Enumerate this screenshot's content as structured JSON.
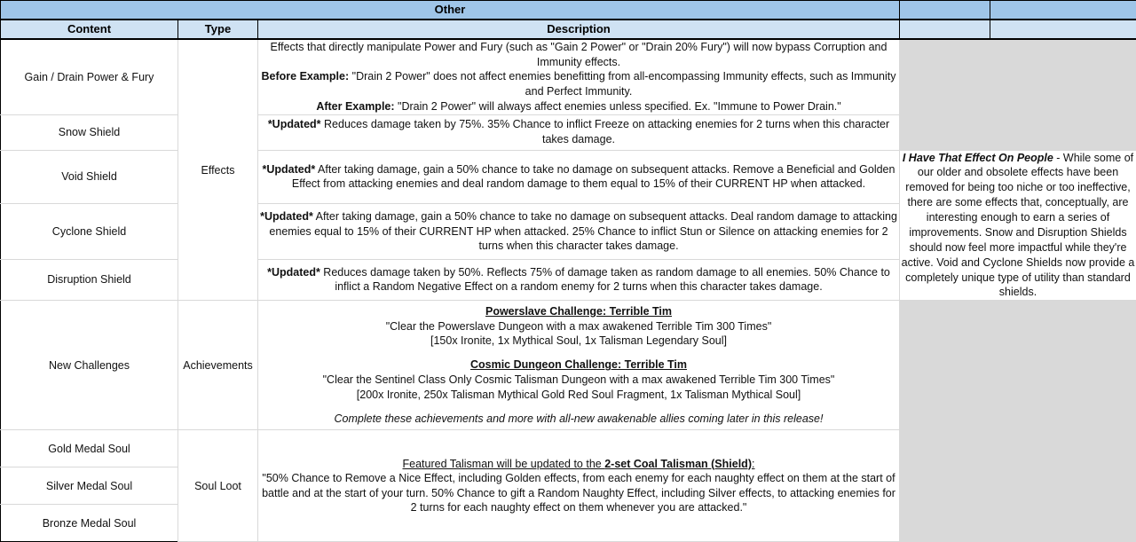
{
  "sheet": {
    "title": "Other",
    "columns": {
      "content": "Content",
      "type": "Type",
      "description": "Description",
      "extra_1": "",
      "extra_2": ""
    },
    "colors": {
      "title_bg": "#9fc5e8",
      "header_bg": "#cfe2f3",
      "filler_bg": "#d9d9d9",
      "grid_line": "#d9d9d9",
      "outline": "#000000",
      "text": "#111111"
    }
  },
  "rows": {
    "gain_drain": {
      "content": "Gain / Drain Power & Fury",
      "desc": {
        "p1": "Effects that directly manipulate Power and Fury (such as \"Gain 2 Power\" or \"Drain 20% Fury\") will now bypass Corruption and Immunity effects.",
        "before_label": "Before Example:",
        "before_text": " \"Drain 2 Power\" does not affect enemies benefitting from all-encompassing Immunity effects, such as Immunity and Perfect Immunity.",
        "after_label": "After Example:",
        "after_text": " \"Drain 2 Power\" will always affect enemies unless specified. Ex. \"Immune to Power Drain.\""
      }
    },
    "snow_shield": {
      "content": "Snow Shield",
      "updated_tag": "*Updated*",
      "desc": " Reduces damage taken by 75%. 35% Chance to inflict Freeze on attacking enemies for 2 turns when this character takes damage."
    },
    "void_shield": {
      "content": "Void Shield",
      "updated_tag": "*Updated*",
      "desc": " After taking damage, gain a 50% chance to take no damage on subsequent attacks. Remove a Beneficial and Golden Effect from attacking enemies and deal random damage to them equal to 15% of their CURRENT HP when attacked."
    },
    "cyclone_shield": {
      "content": "Cyclone Shield",
      "updated_tag": "*Updated*",
      "desc": " After taking damage, gain a 50% chance to take no damage on subsequent attacks. Deal random damage to attacking enemies equal to 15% of their CURRENT HP when attacked. 25% Chance to inflict Stun or Silence on attacking enemies for 2 turns when this character takes damage."
    },
    "disruption_shield": {
      "content": "Disruption Shield",
      "updated_tag": "*Updated*",
      "desc": " Reduces damage taken by 50%. Reflects 75% of damage taken as random damage to all enemies. 50% Chance to inflict a Random Negative Effect on a random enemy for 2 turns when this character takes damage."
    },
    "new_challenges": {
      "content": "New Challenges",
      "challenge_1_title": "Powerslave Challenge: Terrible Tim",
      "challenge_1_desc": "\"Clear the Powerslave Dungeon with a max awakened Terrible Tim 300 Times\"",
      "challenge_1_rewards": "[150x Ironite, 1x Mythical Soul, 1x Talisman Legendary Soul]",
      "challenge_2_title": "Cosmic Dungeon Challenge: Terrible Tim",
      "challenge_2_desc": "\"Clear the Sentinel Class Only Cosmic Talisman Dungeon with a max awakened Terrible Tim 300 Times\"",
      "challenge_2_rewards": "[200x Ironite, 250x Talisman Mythical Gold Red Soul Fragment, 1x Talisman Mythical Soul]",
      "footer": "Complete these achievements and more with all-new awakenable allies coming later in this release!"
    },
    "gold_medal_soul": {
      "content": "Gold Medal Soul"
    },
    "silver_medal_soul": {
      "content": "Silver Medal Soul"
    },
    "bronze_medal_soul": {
      "content": "Bronze Medal Soul"
    },
    "soul_loot_desc": {
      "headline_prefix": "Featured Talisman will be updated to the ",
      "headline_bold": "2-set Coal Talisman (Shield)",
      "headline_suffix": ":",
      "body": "\"50% Chance to Remove a Nice Effect, including Golden effects, from each enemy for each naughty effect on them at the start of battle and at the start of your turn. 50% Chance to gift a Random Naughty Effect, including Silver effects, to attacking enemies for 2 turns for each naughty effect on them whenever you are attacked.\""
    }
  },
  "type_groups": {
    "effects": "Effects",
    "achievements": "Achievements",
    "soul_loot": "Soul Loot"
  },
  "note": {
    "title": "I Have That Effect On People",
    "dash": " - ",
    "body": "While some of our older and obsolete effects have been removed for being too niche or too ineffective, there are some effects that, conceptually, are interesting enough to earn a series of improvements. Snow and Disruption Shields should now feel more impactful while they're active. Void and Cyclone Shields now provide a completely unique type of utility than standard shields."
  }
}
